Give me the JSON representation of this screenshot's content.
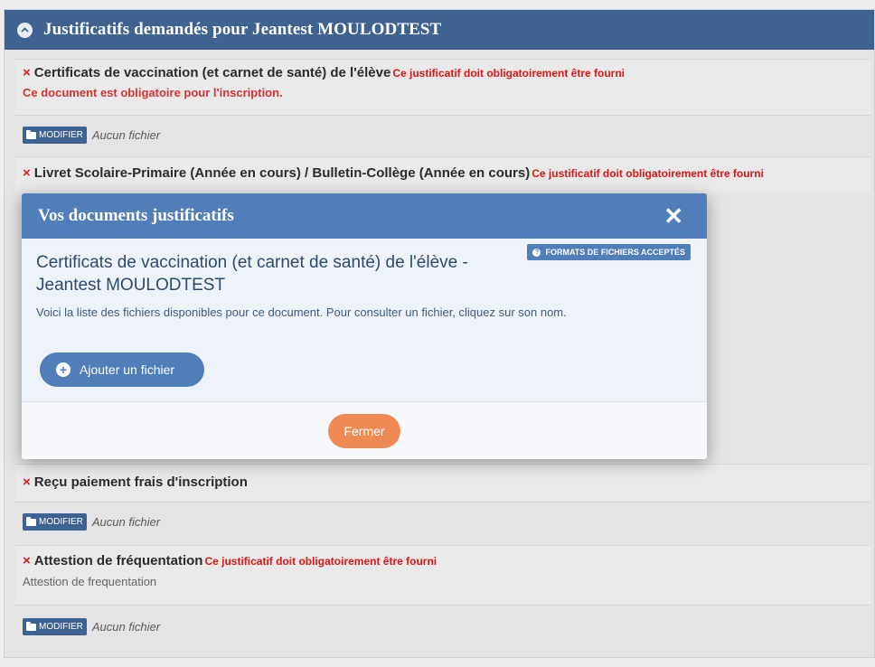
{
  "panel": {
    "title": "Justificatifs demandés pour Jeantest MOULODTEST"
  },
  "docs": [
    {
      "title": "Certificats de vaccination (et carnet de santé) de l'élève",
      "required_note": "Ce justificatif doit obligatoirement être fourni",
      "required_line": "Ce document est obligatoire pour l'inscription.",
      "modify_label": "MODIFIER",
      "file_status": "Aucun fichier"
    },
    {
      "title": "Livret Scolaire-Primaire (Année en cours) / Bulletin-Collège (Année en cours)",
      "required_note": "Ce justificatif doit obligatoirement être fourni"
    },
    {
      "title": "Reçu paiement frais d'inscription",
      "modify_label": "MODIFIER",
      "file_status": "Aucun fichier"
    },
    {
      "title": "Attestion de fréquentation",
      "required_note": "Ce justificatif doit obligatoirement être fourni",
      "description": "Attestion de frequentation",
      "modify_label": "MODIFIER",
      "file_status": "Aucun fichier"
    }
  ],
  "modal": {
    "title": "Vos documents justificatifs",
    "formats_label": "FORMATS DE FICHIERS ACCEPTÉS",
    "doc_title": "Certificats de vaccination (et carnet de santé) de l'élève - Jeantest MOULODTEST",
    "info": "Voici la liste des fichiers disponibles pour ce document. Pour consulter un fichier, cliquez sur son nom.",
    "add_label": "Ajouter un fichier",
    "close_label": "Fermer"
  },
  "colors": {
    "header": "#3f6390",
    "modal_header": "#4f7eb9",
    "close_button": "#f08a54",
    "required": "#e01414"
  }
}
